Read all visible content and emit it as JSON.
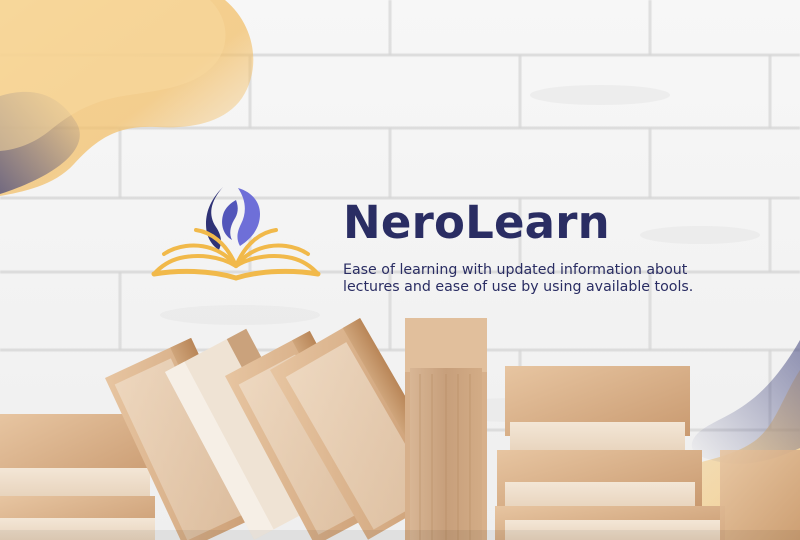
{
  "brand": {
    "name": "NeroLearn",
    "tagline": "Ease of learning with updated information about\nlectures and ease of use by using available tools."
  },
  "colors": {
    "title": "#2a2d63",
    "tagline": "#2a2d63",
    "flame_dark": "#2f3276",
    "flame_light": "#6e6fd8",
    "book_gold": "#f1b94a",
    "blob_gold": "#f5c46e",
    "blob_navy": "#3b3f7a",
    "wall": "#f2f2f2",
    "book_paper": "#d9b28a"
  },
  "icons": [
    "flame-book-logo"
  ]
}
